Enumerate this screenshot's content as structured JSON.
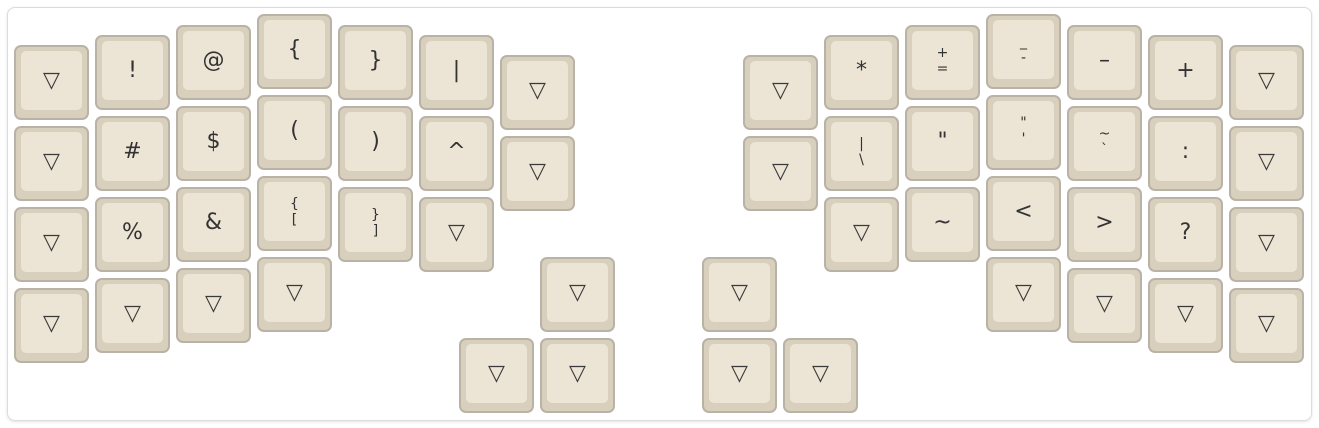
{
  "colors": {
    "key_face": "#ece4d4",
    "key_shell": "#d8cfbd",
    "key_border": "#b9b2a6",
    "legend": "#333333"
  },
  "transparent_symbol": "▽",
  "keys": [
    {
      "id": "L-pinky-outer-r0",
      "legend": "▽",
      "type": "transparent"
    },
    {
      "id": "L-pinky-r0",
      "legend": "!"
    },
    {
      "id": "L-ring-r0",
      "legend": "@"
    },
    {
      "id": "L-middle-r0",
      "legend": "{"
    },
    {
      "id": "L-index-r0",
      "legend": "}"
    },
    {
      "id": "L-inner-r0",
      "legend": "|"
    },
    {
      "id": "L-innermost-r0",
      "legend": "▽",
      "type": "transparent"
    },
    {
      "id": "L-pinky-outer-r1",
      "legend": "▽",
      "type": "transparent"
    },
    {
      "id": "L-pinky-r1",
      "legend": "#"
    },
    {
      "id": "L-ring-r1",
      "legend": "$"
    },
    {
      "id": "L-middle-r1",
      "legend": "("
    },
    {
      "id": "L-index-r1",
      "legend": ")"
    },
    {
      "id": "L-inner-r1",
      "legend": "^"
    },
    {
      "id": "L-innermost-r1",
      "legend": "▽",
      "type": "transparent"
    },
    {
      "id": "L-pinky-outer-r2",
      "legend": "▽",
      "type": "transparent"
    },
    {
      "id": "L-pinky-r2",
      "legend": "%"
    },
    {
      "id": "L-ring-r2",
      "legend": "&"
    },
    {
      "id": "L-middle-r2",
      "top": "{",
      "bottom": "["
    },
    {
      "id": "L-index-r2",
      "top": "}",
      "bottom": "]"
    },
    {
      "id": "L-inner-r2",
      "legend": "▽",
      "type": "transparent"
    },
    {
      "id": "L-pinky-outer-r3",
      "legend": "▽",
      "type": "transparent"
    },
    {
      "id": "L-pinky-r3",
      "legend": "▽",
      "type": "transparent"
    },
    {
      "id": "L-ring-r3",
      "legend": "▽",
      "type": "transparent"
    },
    {
      "id": "L-middle-r3",
      "legend": "▽",
      "type": "transparent"
    },
    {
      "id": "L-thumb-upper",
      "legend": "▽",
      "type": "transparent"
    },
    {
      "id": "L-thumb-lower-1",
      "legend": "▽",
      "type": "transparent"
    },
    {
      "id": "L-thumb-lower-2",
      "legend": "▽",
      "type": "transparent"
    },
    {
      "id": "R-innermost-r0",
      "legend": "▽",
      "type": "transparent"
    },
    {
      "id": "R-inner-r0",
      "legend": "*"
    },
    {
      "id": "R-index-r0",
      "top": "+",
      "bottom": "="
    },
    {
      "id": "R-middle-r0",
      "top": "_",
      "bottom": "-"
    },
    {
      "id": "R-ring-r0",
      "legend": "–"
    },
    {
      "id": "R-pinky-r0",
      "legend": "+"
    },
    {
      "id": "R-pinky-outer-r0",
      "legend": "▽",
      "type": "transparent"
    },
    {
      "id": "R-innermost-r1",
      "legend": "▽",
      "type": "transparent"
    },
    {
      "id": "R-inner-r1",
      "top": "|",
      "bottom": "\\"
    },
    {
      "id": "R-index-r1",
      "legend": "\""
    },
    {
      "id": "R-middle-r1",
      "top": "\"",
      "bottom": "'"
    },
    {
      "id": "R-ring-r1",
      "top": "~",
      "bottom": "`"
    },
    {
      "id": "R-pinky-r1",
      "legend": ":"
    },
    {
      "id": "R-pinky-outer-r1",
      "legend": "▽",
      "type": "transparent"
    },
    {
      "id": "R-inner-r2",
      "legend": "▽",
      "type": "transparent"
    },
    {
      "id": "R-index-r2",
      "legend": "~"
    },
    {
      "id": "R-middle-r2",
      "legend": "<"
    },
    {
      "id": "R-ring-r2",
      "legend": ">"
    },
    {
      "id": "R-pinky-r2",
      "legend": "?"
    },
    {
      "id": "R-pinky-outer-r2",
      "legend": "▽",
      "type": "transparent"
    },
    {
      "id": "R-middle-r3",
      "legend": "▽",
      "type": "transparent"
    },
    {
      "id": "R-ring-r3",
      "legend": "▽",
      "type": "transparent"
    },
    {
      "id": "R-pinky-r3",
      "legend": "▽",
      "type": "transparent"
    },
    {
      "id": "R-pinky-outer-r3",
      "legend": "▽",
      "type": "transparent"
    },
    {
      "id": "R-thumb-upper",
      "legend": "▽",
      "type": "transparent"
    },
    {
      "id": "R-thumb-lower-1",
      "legend": "▽",
      "type": "transparent"
    },
    {
      "id": "R-thumb-lower-2",
      "legend": "▽",
      "type": "transparent"
    }
  ]
}
